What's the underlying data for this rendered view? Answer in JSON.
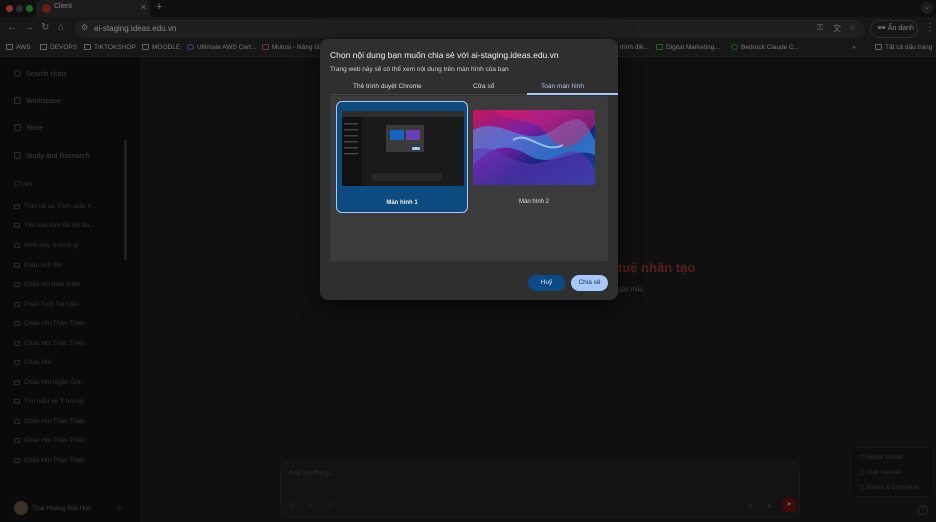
{
  "browser": {
    "tab_title": "Client",
    "url": "ai-staging.ideas.edu.vn",
    "incognito_label": "Ẩn danh",
    "bookmarks": [
      "AWS",
      "DEVOPS",
      "TIKTOKSHOP",
      "MOODLE",
      "Ultimate AWS Cert...",
      "Mutosi - Nâng tầ",
      "trình điề...",
      "Digital Marketing...",
      "Bedrock Claude C...",
      "Tất cả dấu trang"
    ],
    "more_bookmarks": "»",
    "colors": {
      "traffic_red": "#ff5f57",
      "traffic_yellow": "#febc2e",
      "traffic_green": "#28c840"
    }
  },
  "sidebar": {
    "search_label": "Search chats",
    "nav": [
      "Workspace",
      "Store",
      "Study and Research"
    ],
    "chats_heading": "Chats",
    "chats": [
      "Tóm tắt và Trích xuất Ý...",
      "Yêu cầu tóm tắt nội du...",
      "Hình này là hình gì",
      "Phân tích file",
      "Chào hỏi thân thiện",
      "Phân Tích Tài Liệu",
      "Chào Hỏi Thân Thiện",
      "Chào Hỏi Thân Thiện",
      "Chào Hỏi",
      "Chào Hỏi Ngắn Gọn",
      "Tìm hiểu về Ý tưởng",
      "Chào Hỏi Thân Thiện",
      "Chào Hỏi Thân Thiện",
      "Chào Hỏi Thân Thiện"
    ],
    "user_name": "Thái Hoàng Mai Học"
  },
  "main": {
    "hero_title": "tuệ nhân tạo",
    "hero_sub": "gặp mắc,",
    "composer_placeholder": "Ask anything...",
    "help": [
      "Helper center",
      "User manual",
      "Report & Contribute"
    ]
  },
  "dialog": {
    "title": "Chọn nội dung bạn muốn chia sẻ với ai-staging.ideas.edu.vn",
    "subtitle": "Trang web này sẽ có thể xem nội dung trên màn hình của bạn",
    "tabs": [
      "Thẻ trình duyệt Chrome",
      "Cửa sổ",
      "Toàn màn hình"
    ],
    "active_tab": "Toàn màn hình",
    "screens": [
      "Màn hình 1",
      "Màn hình 2"
    ],
    "cancel_label": "Huỷ",
    "share_label": "Chia sẻ",
    "accent_color": "#a8c7fa"
  }
}
